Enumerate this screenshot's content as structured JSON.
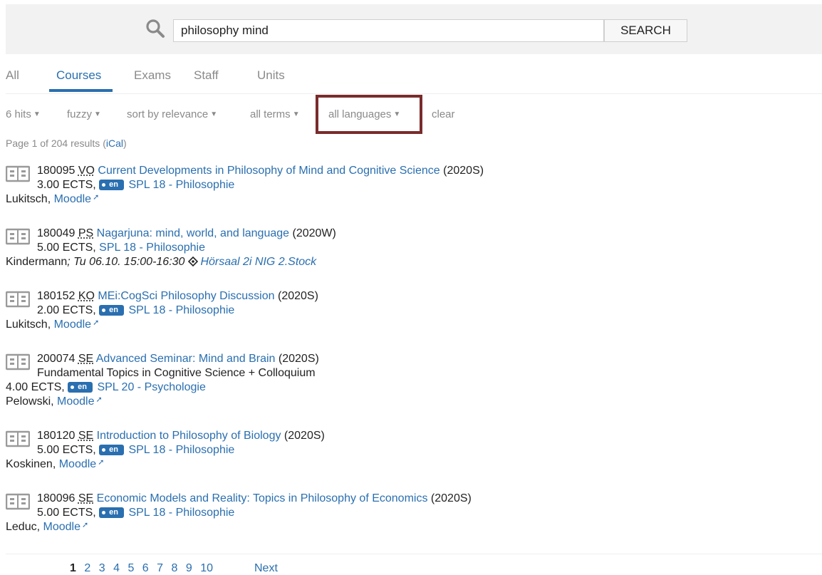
{
  "search": {
    "query": "philosophy mind",
    "button_label": "SEARCH"
  },
  "tabs": [
    "All",
    "Courses",
    "Exams",
    "Staff",
    "Units"
  ],
  "active_tab": "Courses",
  "filters": {
    "hits": "6 hits",
    "fuzzy": "fuzzy",
    "sort": "sort by relevance",
    "terms": "all terms",
    "languages": "all languages",
    "clear": "clear"
  },
  "page_info": {
    "text": "Page 1 of 204 results (",
    "link": "iCal",
    "suffix": ")"
  },
  "results": [
    {
      "code": "180095",
      "type": "VO",
      "title": "Current Developments in Philosophy of Mind and Cognitive Science",
      "term": "(2020S)",
      "ects": "3.00 ECTS,",
      "lang": "en",
      "unit": "SPL 18 - Philosophie",
      "lecturer": "Lukitsch,",
      "moodle": "Moodle"
    },
    {
      "code": "180049",
      "type": "PS",
      "title": "Nagarjuna: mind, world, and language",
      "term": "(2020W)",
      "ects": "5.00 ECTS,",
      "unit": "SPL 18 - Philosophie",
      "lecturer": "Kindermann",
      "schedule": "; Tu 06.10. 15:00-16:30",
      "room": "Hörsaal 2i NIG 2.Stock"
    },
    {
      "code": "180152",
      "type": "KO",
      "title": "MEi:CogSci Philosophy Discussion",
      "term": "(2020S)",
      "ects": "2.00 ECTS,",
      "lang": "en",
      "unit": "SPL 18 - Philosophie",
      "lecturer": "Lukitsch,",
      "moodle": "Moodle"
    },
    {
      "code": "200074",
      "type": "SE",
      "title": "Advanced Seminar: Mind and Brain",
      "term": "(2020S)",
      "subtitle": "Fundamental Topics in Cognitive Science + Colloquium",
      "ects": "4.00 ECTS,",
      "lang": "en",
      "unit": "SPL 20 - Psychologie",
      "lecturer": "Pelowski,",
      "moodle": "Moodle"
    },
    {
      "code": "180120",
      "type": "SE",
      "title": "Introduction to Philosophy of Biology",
      "term": "(2020S)",
      "ects": "5.00 ECTS,",
      "lang": "en",
      "unit": "SPL 18 - Philosophie",
      "lecturer": "Koskinen,",
      "moodle": "Moodle"
    },
    {
      "code": "180096",
      "type": "SE",
      "title": "Economic Models and Reality: Topics in Philosophy of Economics",
      "term": "(2020S)",
      "ects": "5.00 ECTS,",
      "lang": "en",
      "unit": "SPL 18 - Philosophie",
      "lecturer": "Leduc,",
      "moodle": "Moodle"
    }
  ],
  "pagination": {
    "pages": [
      "1",
      "2",
      "3",
      "4",
      "5",
      "6",
      "7",
      "8",
      "9",
      "10"
    ],
    "current": "1",
    "next": "Next"
  },
  "colors": {
    "link": "#2a6fb0",
    "highlight_box": "#7a2b2b",
    "muted": "#8a8a8a"
  },
  "icons": {
    "search": "search-icon",
    "result": "book-icon",
    "external": "external-link-icon",
    "location": "location-icon"
  }
}
